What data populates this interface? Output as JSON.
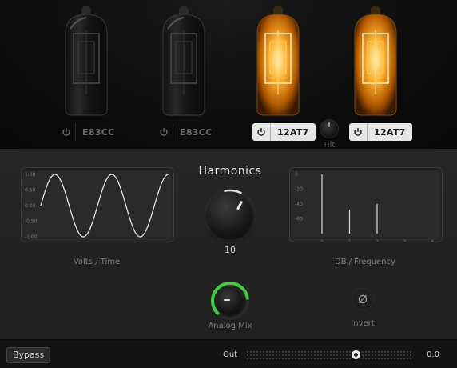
{
  "tubes": [
    {
      "label": "E83CC",
      "state": "off"
    },
    {
      "label": "E83CC",
      "state": "off"
    },
    {
      "label": "12AT7",
      "state": "on"
    },
    {
      "label": "12AT7",
      "state": "on"
    }
  ],
  "tilt": {
    "label": "Tilt"
  },
  "harmonics": {
    "title": "Harmonics",
    "value": "10"
  },
  "scope": {
    "caption": "Volts / Time",
    "y_ticks": [
      "1.00",
      "0.50",
      "0.00",
      "-0.50",
      "-1.00"
    ]
  },
  "spectrum": {
    "caption": "DB / Frequency",
    "y_ticks": [
      "0",
      "-20",
      "-40",
      "-60"
    ],
    "x_ticks": [
      "0",
      "1",
      "2",
      "3",
      "4"
    ]
  },
  "analog_mix": {
    "label": "Analog Mix",
    "level": 0.8,
    "accent": "#3fcf3f"
  },
  "invert": {
    "label": "Invert"
  },
  "bottom": {
    "bypass": "Bypass",
    "out_label": "Out",
    "out_value": "0.0"
  },
  "colors": {
    "glow": "#ffb233",
    "accent": "#3fcf3f"
  },
  "chart_data": [
    {
      "type": "line",
      "x": [
        0,
        0.125,
        0.25,
        0.375,
        0.5,
        0.625,
        0.75,
        0.875,
        1.0,
        1.125,
        1.25,
        1.375,
        1.5,
        1.625,
        1.75,
        1.875,
        2.0,
        2.125,
        2.25
      ],
      "y": [
        0,
        0.71,
        1.0,
        0.71,
        0,
        -0.71,
        -1.0,
        -0.71,
        0,
        0.71,
        1.0,
        0.71,
        0,
        -0.71,
        -1.0,
        -0.71,
        0,
        0.71,
        1.0
      ],
      "ylim": [
        -1.0,
        1.0
      ],
      "grid": false
    },
    {
      "type": "bar",
      "categories": [
        "0",
        "1",
        "2",
        "3",
        "4"
      ],
      "values": [
        0,
        -48,
        -40,
        -82,
        -90
      ],
      "ylim": [
        -80,
        0
      ]
    }
  ]
}
